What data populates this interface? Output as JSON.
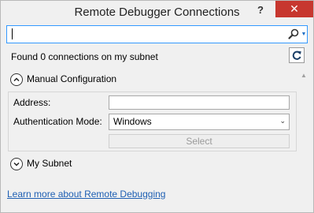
{
  "window": {
    "title": "Remote Debugger Connections",
    "help_label": "?",
    "close_label": "✕"
  },
  "search": {
    "value": "",
    "icon": "search-icon",
    "dropdown_icon": "▼"
  },
  "status": {
    "text": "Found 0 connections on my subnet",
    "refresh_icon": "refresh-icon"
  },
  "manual_config": {
    "header": "Manual Configuration",
    "expanded": true,
    "address_label": "Address:",
    "address_value": "",
    "auth_label": "Authentication Mode:",
    "auth_value": "Windows",
    "select_label": "Select"
  },
  "my_subnet": {
    "header": "My Subnet",
    "expanded": false
  },
  "footer": {
    "link_text": "Learn more about Remote Debugging"
  },
  "colors": {
    "close_button": "#c7372f",
    "focus_border": "#3399ff",
    "link": "#1e5fb3"
  }
}
